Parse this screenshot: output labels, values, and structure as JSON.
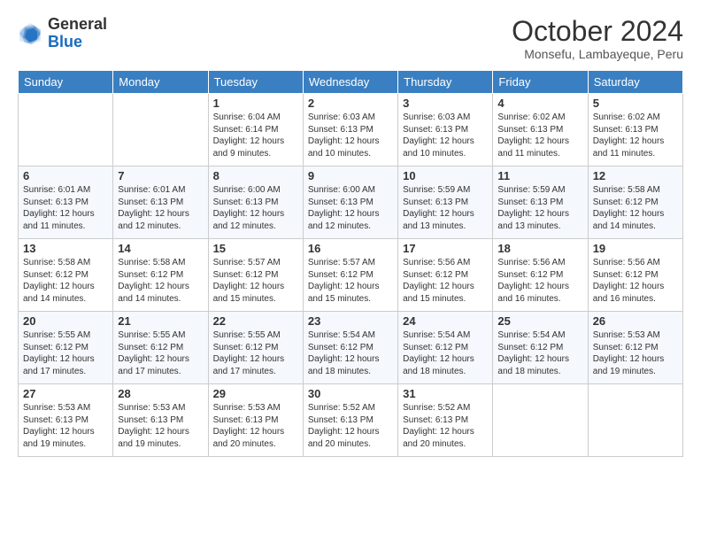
{
  "logo": {
    "general": "General",
    "blue": "Blue"
  },
  "title": "October 2024",
  "subtitle": "Monsefu, Lambayeque, Peru",
  "days_of_week": [
    "Sunday",
    "Monday",
    "Tuesday",
    "Wednesday",
    "Thursday",
    "Friday",
    "Saturday"
  ],
  "weeks": [
    [
      {
        "day": "",
        "info": ""
      },
      {
        "day": "",
        "info": ""
      },
      {
        "day": "1",
        "info": "Sunrise: 6:04 AM\nSunset: 6:14 PM\nDaylight: 12 hours and 9 minutes."
      },
      {
        "day": "2",
        "info": "Sunrise: 6:03 AM\nSunset: 6:13 PM\nDaylight: 12 hours and 10 minutes."
      },
      {
        "day": "3",
        "info": "Sunrise: 6:03 AM\nSunset: 6:13 PM\nDaylight: 12 hours and 10 minutes."
      },
      {
        "day": "4",
        "info": "Sunrise: 6:02 AM\nSunset: 6:13 PM\nDaylight: 12 hours and 11 minutes."
      },
      {
        "day": "5",
        "info": "Sunrise: 6:02 AM\nSunset: 6:13 PM\nDaylight: 12 hours and 11 minutes."
      }
    ],
    [
      {
        "day": "6",
        "info": "Sunrise: 6:01 AM\nSunset: 6:13 PM\nDaylight: 12 hours and 11 minutes."
      },
      {
        "day": "7",
        "info": "Sunrise: 6:01 AM\nSunset: 6:13 PM\nDaylight: 12 hours and 12 minutes."
      },
      {
        "day": "8",
        "info": "Sunrise: 6:00 AM\nSunset: 6:13 PM\nDaylight: 12 hours and 12 minutes."
      },
      {
        "day": "9",
        "info": "Sunrise: 6:00 AM\nSunset: 6:13 PM\nDaylight: 12 hours and 12 minutes."
      },
      {
        "day": "10",
        "info": "Sunrise: 5:59 AM\nSunset: 6:13 PM\nDaylight: 12 hours and 13 minutes."
      },
      {
        "day": "11",
        "info": "Sunrise: 5:59 AM\nSunset: 6:13 PM\nDaylight: 12 hours and 13 minutes."
      },
      {
        "day": "12",
        "info": "Sunrise: 5:58 AM\nSunset: 6:12 PM\nDaylight: 12 hours and 14 minutes."
      }
    ],
    [
      {
        "day": "13",
        "info": "Sunrise: 5:58 AM\nSunset: 6:12 PM\nDaylight: 12 hours and 14 minutes."
      },
      {
        "day": "14",
        "info": "Sunrise: 5:58 AM\nSunset: 6:12 PM\nDaylight: 12 hours and 14 minutes."
      },
      {
        "day": "15",
        "info": "Sunrise: 5:57 AM\nSunset: 6:12 PM\nDaylight: 12 hours and 15 minutes."
      },
      {
        "day": "16",
        "info": "Sunrise: 5:57 AM\nSunset: 6:12 PM\nDaylight: 12 hours and 15 minutes."
      },
      {
        "day": "17",
        "info": "Sunrise: 5:56 AM\nSunset: 6:12 PM\nDaylight: 12 hours and 15 minutes."
      },
      {
        "day": "18",
        "info": "Sunrise: 5:56 AM\nSunset: 6:12 PM\nDaylight: 12 hours and 16 minutes."
      },
      {
        "day": "19",
        "info": "Sunrise: 5:56 AM\nSunset: 6:12 PM\nDaylight: 12 hours and 16 minutes."
      }
    ],
    [
      {
        "day": "20",
        "info": "Sunrise: 5:55 AM\nSunset: 6:12 PM\nDaylight: 12 hours and 17 minutes."
      },
      {
        "day": "21",
        "info": "Sunrise: 5:55 AM\nSunset: 6:12 PM\nDaylight: 12 hours and 17 minutes."
      },
      {
        "day": "22",
        "info": "Sunrise: 5:55 AM\nSunset: 6:12 PM\nDaylight: 12 hours and 17 minutes."
      },
      {
        "day": "23",
        "info": "Sunrise: 5:54 AM\nSunset: 6:12 PM\nDaylight: 12 hours and 18 minutes."
      },
      {
        "day": "24",
        "info": "Sunrise: 5:54 AM\nSunset: 6:12 PM\nDaylight: 12 hours and 18 minutes."
      },
      {
        "day": "25",
        "info": "Sunrise: 5:54 AM\nSunset: 6:12 PM\nDaylight: 12 hours and 18 minutes."
      },
      {
        "day": "26",
        "info": "Sunrise: 5:53 AM\nSunset: 6:12 PM\nDaylight: 12 hours and 19 minutes."
      }
    ],
    [
      {
        "day": "27",
        "info": "Sunrise: 5:53 AM\nSunset: 6:13 PM\nDaylight: 12 hours and 19 minutes."
      },
      {
        "day": "28",
        "info": "Sunrise: 5:53 AM\nSunset: 6:13 PM\nDaylight: 12 hours and 19 minutes."
      },
      {
        "day": "29",
        "info": "Sunrise: 5:53 AM\nSunset: 6:13 PM\nDaylight: 12 hours and 20 minutes."
      },
      {
        "day": "30",
        "info": "Sunrise: 5:52 AM\nSunset: 6:13 PM\nDaylight: 12 hours and 20 minutes."
      },
      {
        "day": "31",
        "info": "Sunrise: 5:52 AM\nSunset: 6:13 PM\nDaylight: 12 hours and 20 minutes."
      },
      {
        "day": "",
        "info": ""
      },
      {
        "day": "",
        "info": ""
      }
    ]
  ]
}
